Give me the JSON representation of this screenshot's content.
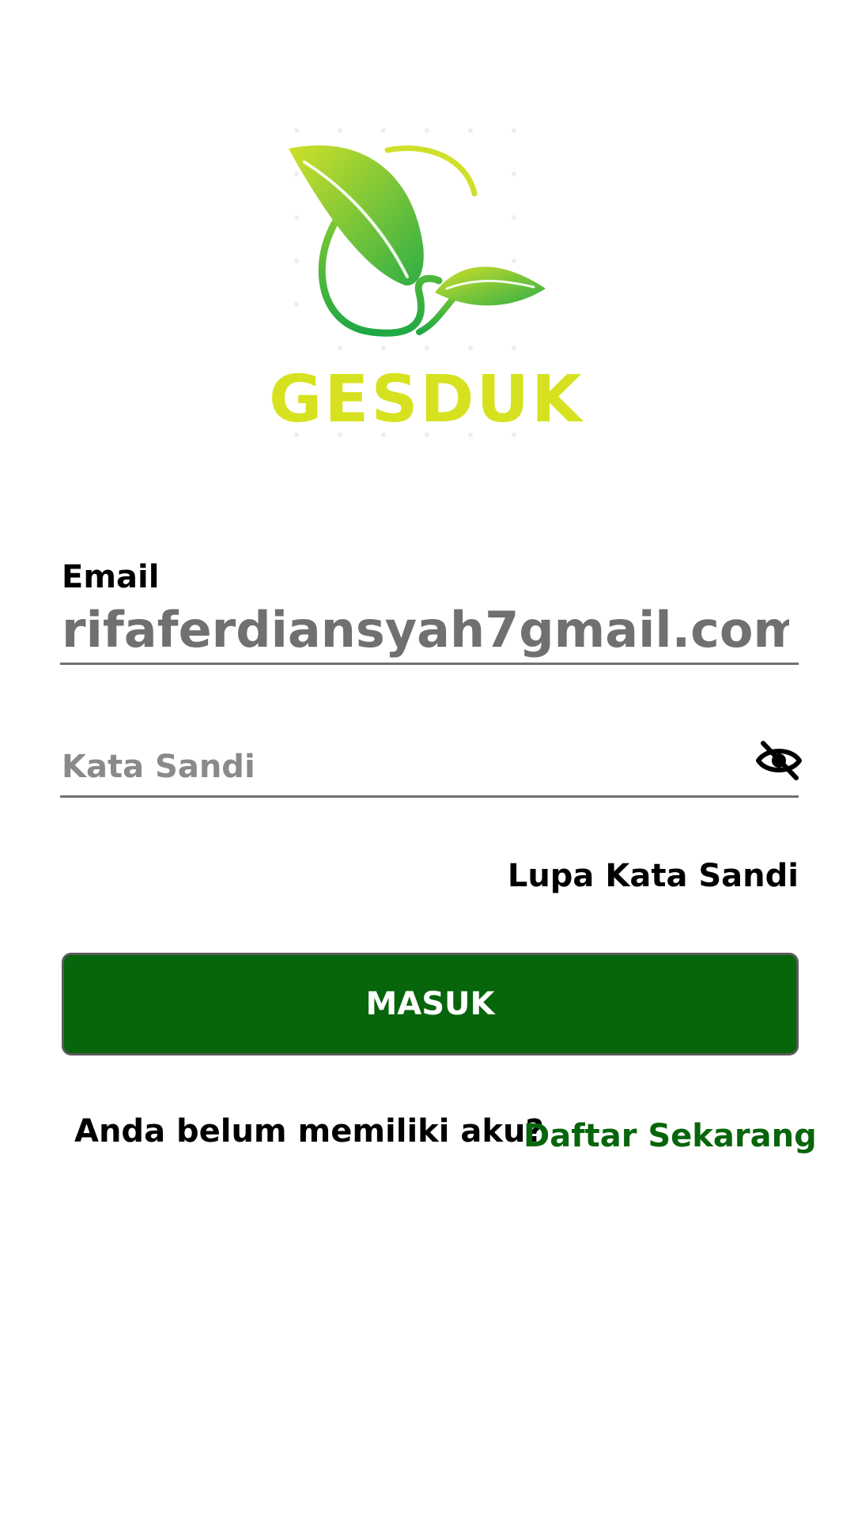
{
  "app": {
    "brand_name": "GESDUK",
    "colors": {
      "primary": "#07650b",
      "brand_green": "#2fb34a",
      "brand_lime": "#d6e21f",
      "text": "#000000",
      "muted_text": "#707070"
    }
  },
  "form": {
    "email": {
      "label": "Email",
      "value": "rifaferdiansyah7gmail.com"
    },
    "password": {
      "placeholder": "Kata Sandi",
      "visibility_icon": "eye-off-icon"
    },
    "forgot_label": "Lupa Kata Sandi",
    "submit_label": "MASUK"
  },
  "signup": {
    "prompt": "Anda belum memiliki aku?",
    "link_label": "Daftar Sekarang"
  }
}
